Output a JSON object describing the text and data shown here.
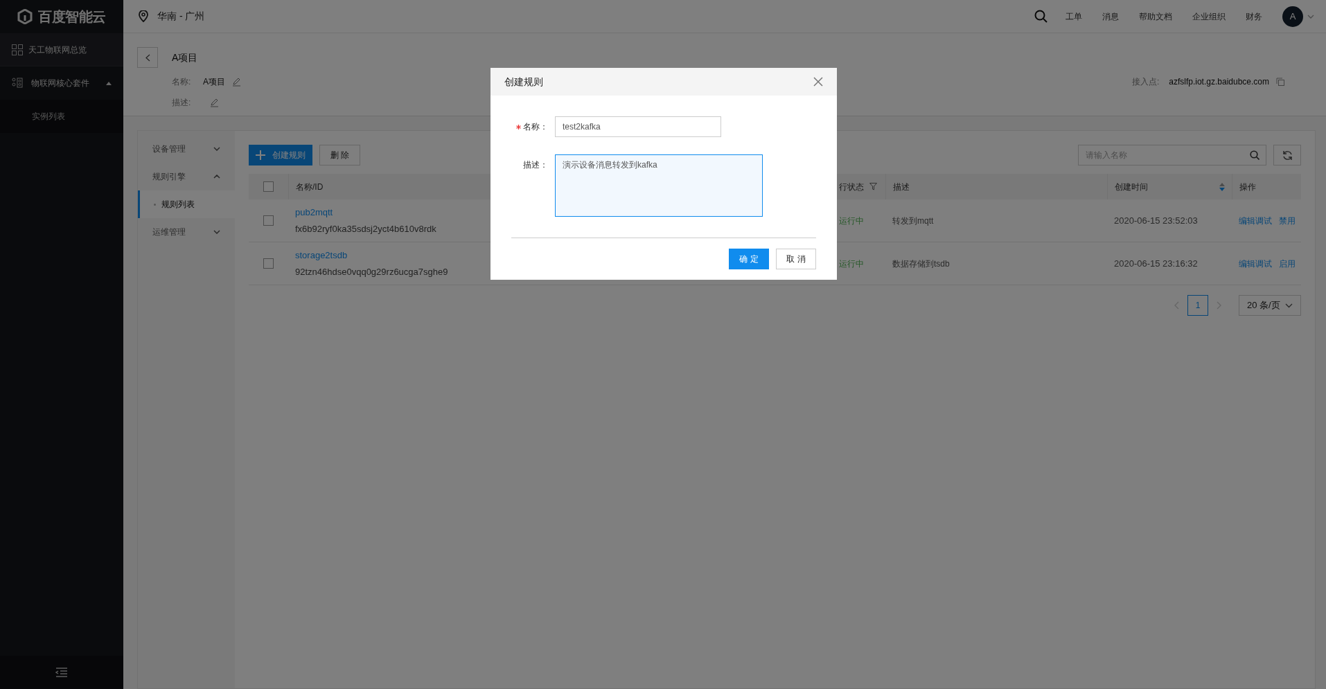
{
  "sidebar": {
    "logo": "百度智能云",
    "items": [
      {
        "label": "天工物联网总览",
        "kind": "link"
      },
      {
        "label": "物联网核心套件",
        "kind": "group",
        "expanded": true,
        "children": [
          {
            "label": "实例列表"
          }
        ]
      }
    ]
  },
  "header": {
    "region": "华南 - 广州",
    "links": [
      "工单",
      "消息",
      "帮助文档",
      "企业组织",
      "财务"
    ],
    "avatar": "A"
  },
  "project": {
    "title": "A项目",
    "name_label": "名称:",
    "name_value": "A项目",
    "desc_label": "描述:",
    "endpoint_label": "接入点:",
    "endpoint_value": "azfslfp.iot.gz.baidubce.com"
  },
  "subnav": [
    {
      "label": "设备管理",
      "expanded": false
    },
    {
      "label": "规则引擎",
      "expanded": true,
      "children": [
        {
          "label": "规则列表",
          "selected": true
        }
      ]
    },
    {
      "label": "运维管理",
      "expanded": false
    }
  ],
  "toolbar": {
    "create": "创建规则",
    "delete": "删 除",
    "search_placeholder": "请输入名称"
  },
  "table": {
    "select_all": {
      "checked": false
    },
    "columns": [
      "名称/ID",
      "行状态",
      "描述",
      "创建时间",
      "操作"
    ],
    "rows": [
      {
        "checked": false,
        "name": "pub2mqtt",
        "id": "fx6b92ryf0ka35sdsj2yct4b610v8rdk",
        "status": "运行中",
        "description": "转发到mqtt",
        "created": "2020-06-15 23:52:03",
        "actions": [
          "编辑调试",
          "禁用"
        ]
      },
      {
        "checked": false,
        "name": "storage2tsdb",
        "id": "92tzn46hdse0vqq0g29rz6ucga7sghe9",
        "status": "运行中",
        "description": "数据存储到tsdb",
        "created": "2020-06-15 23:16:32",
        "actions": [
          "编辑调试",
          "启用"
        ]
      }
    ]
  },
  "pagination": {
    "pages": [
      {
        "label": "1",
        "selected": true
      }
    ],
    "page_size": "20 条/页"
  },
  "dialog": {
    "title": "创建规则",
    "fields": [
      {
        "kind": "input",
        "label": "名称：",
        "required": true,
        "value": "test2kafka",
        "focused": false
      },
      {
        "kind": "textarea",
        "label": "描述：",
        "required": false,
        "value": "演示设备消息转发到kafka",
        "focused": true
      }
    ],
    "confirm": "确 定",
    "cancel": "取 消"
  }
}
